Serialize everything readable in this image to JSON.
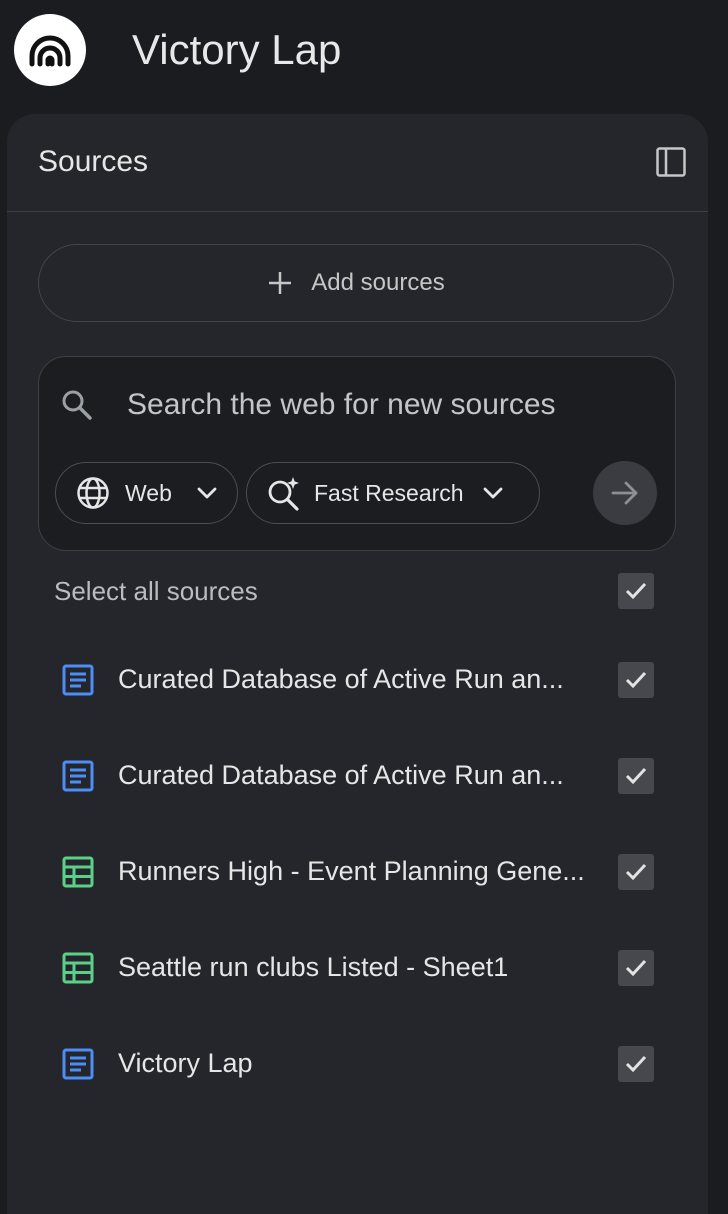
{
  "app": {
    "title": "Victory Lap",
    "logo_icon": "notebook-waves-icon"
  },
  "sources_panel": {
    "title": "Sources",
    "collapse_icon": "panel-collapse-icon",
    "add_sources_label": "Add sources",
    "add_icon": "plus-icon",
    "search": {
      "placeholder": "Search the web for new sources",
      "value": "",
      "icon": "search-icon",
      "source_chip_label": "Web",
      "source_chip_icon": "globe-icon",
      "mode_chip_label": "Fast Research",
      "mode_chip_icon": "sparkle-search-icon",
      "submit_icon": "arrow-right-icon"
    },
    "select_all_label": "Select all sources",
    "select_all_checked": true,
    "items": [
      {
        "label": "Curated Database of Active Run an...",
        "type": "document",
        "checked": true
      },
      {
        "label": "Curated Database of Active Run an...",
        "type": "document",
        "checked": true
      },
      {
        "label": "Runners High - Event Planning Gene...",
        "type": "spreadsheet",
        "checked": true
      },
      {
        "label": "Seattle run clubs Listed - Sheet1",
        "type": "spreadsheet",
        "checked": true
      },
      {
        "label": "Victory Lap",
        "type": "document",
        "checked": true
      }
    ]
  },
  "colors": {
    "background": "#1b1c20",
    "panel": "#24262b",
    "document_icon": "#4c8df6",
    "spreadsheet_icon": "#5bd08a",
    "checkbox_fill": "#46484d"
  }
}
